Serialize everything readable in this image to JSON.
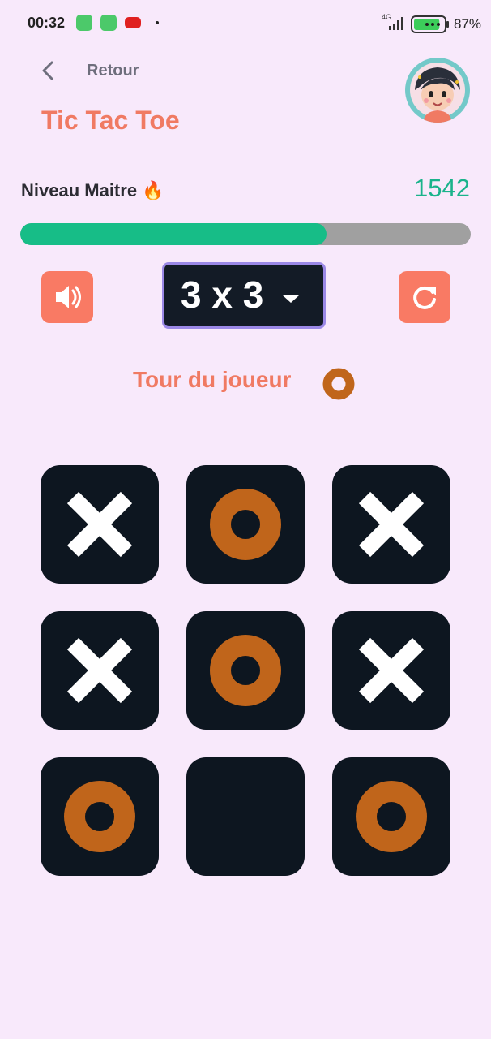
{
  "status_bar": {
    "time": "00:32",
    "network": "4G",
    "battery_pct": "87%",
    "battery_level": 0.87
  },
  "header": {
    "back_label": "Retour",
    "title": "Tic Tac Toe"
  },
  "level": {
    "name": "Niveau Maitre 🔥",
    "score": "1542",
    "progress": 0.68
  },
  "controls": {
    "sound_icon": "speaker-icon",
    "grid_size": "3 x 3",
    "restart_icon": "refresh-icon"
  },
  "turn": {
    "label": "Tour du joueur",
    "player": "O"
  },
  "board": {
    "cells": [
      "X",
      "O",
      "X",
      "X",
      "O",
      "X",
      "O",
      "",
      "O"
    ]
  },
  "colors": {
    "background": "#f8e9fb",
    "accent": "#f97a64",
    "o_mark": "#c0651b",
    "x_mark": "#ffffff",
    "cell": "#0d1620",
    "progress": "#17bd87",
    "score": "#1ab38b"
  }
}
